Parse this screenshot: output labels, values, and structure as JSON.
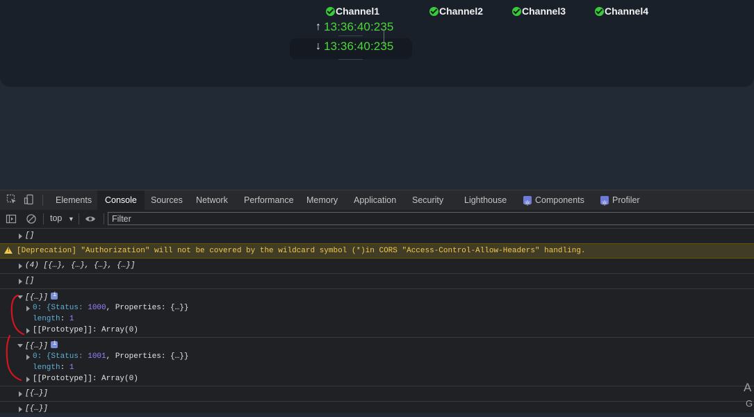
{
  "app": {
    "channels": [
      "Channel1",
      "Channel2",
      "Channel3",
      "Channel4"
    ],
    "time_up": "13:36:40:235",
    "time_down": "13:36:40:235",
    "up_arrow": "↑",
    "down_arrow": "↓",
    "colors": {
      "time": "#4cd63a",
      "check": "#39c93c"
    }
  },
  "devtools": {
    "tabs": [
      "Elements",
      "Console",
      "Sources",
      "Network",
      "Performance",
      "Memory",
      "Application",
      "Security",
      "Lighthouse",
      "Components",
      "Profiler"
    ],
    "active_tab": "Console",
    "context": "top",
    "filter_placeholder": "Filter"
  },
  "console": {
    "r1": "[]",
    "warning": "[Deprecation] \"Authorization\" will not be covered by the wildcard symbol (*)in CORS \"Access-Control-Allow-Headers\" handling.",
    "r3": "(4) [{…}, {…}, {…}, {…}]",
    "r4": "[]",
    "group1": {
      "head": "[{…}]",
      "item_prefix": "0: {Status: ",
      "status": "1000",
      "item_suffix": ", Properties: {…}}",
      "length_key": "length",
      "length_val": "1",
      "proto": "[[Prototype]]: Array(0)"
    },
    "group2": {
      "head": "[{…}]",
      "item_prefix": "0: {Status: ",
      "status": "1001",
      "item_suffix": ", Properties: {…}}",
      "length_key": "length",
      "length_val": "1",
      "proto": "[[Prototype]]: Array(0)"
    },
    "r7": "[{…}]",
    "r8": "[{…}]"
  },
  "watermark": {
    "line1": "A",
    "line2": "G"
  }
}
